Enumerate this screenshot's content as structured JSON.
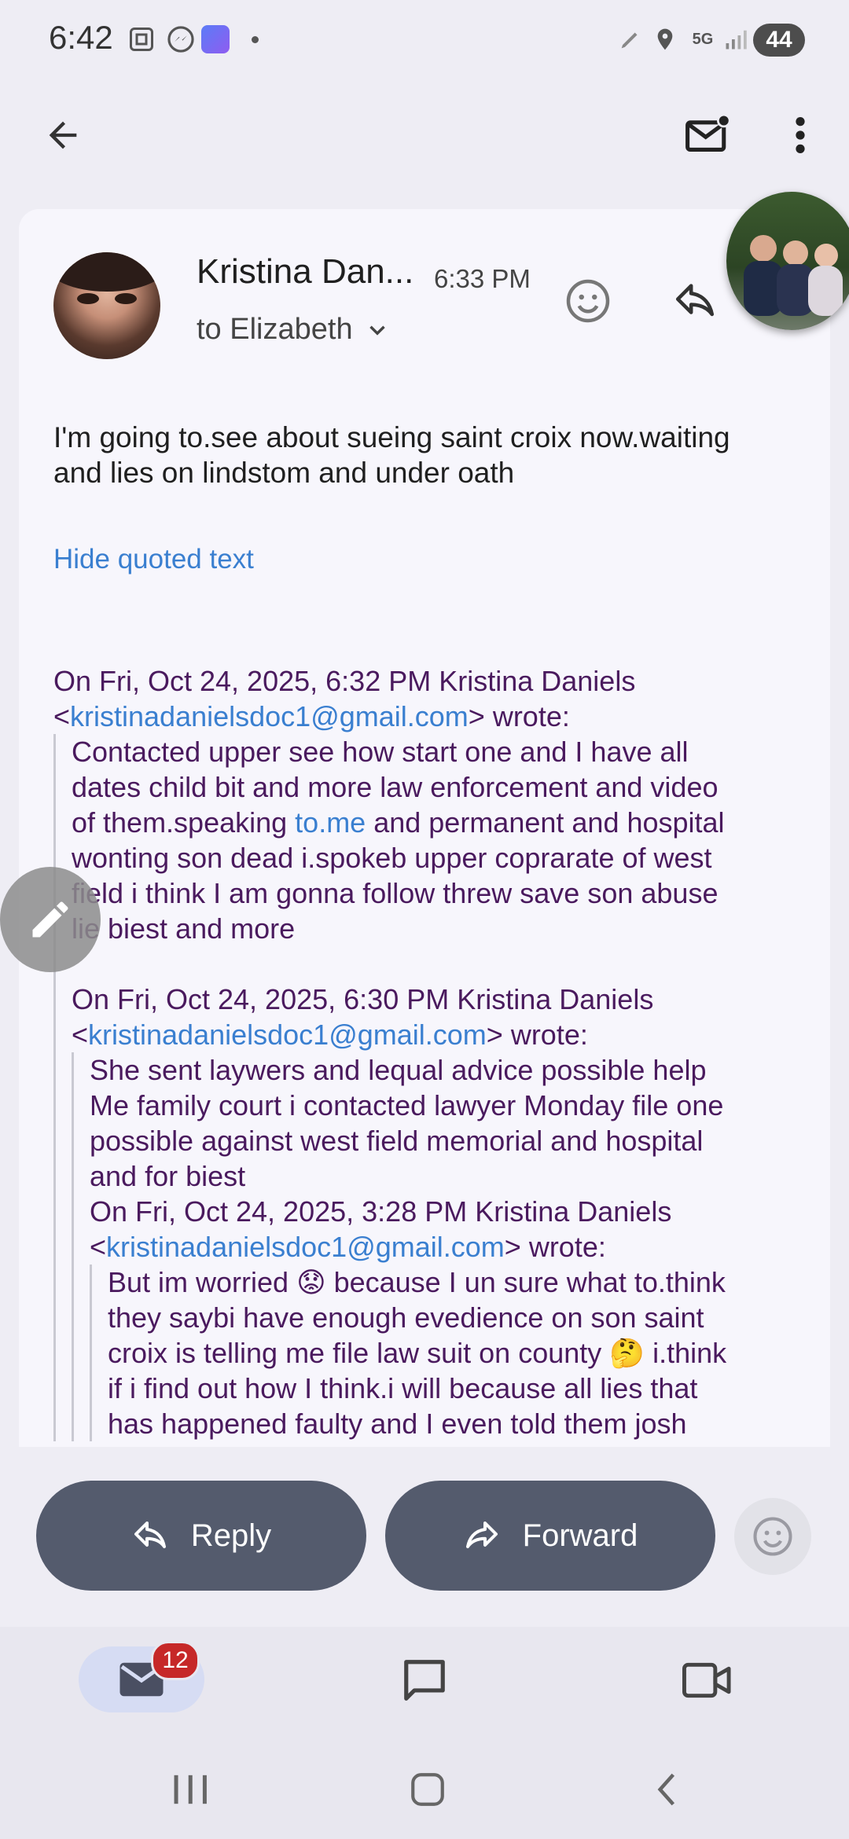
{
  "status_bar": {
    "time": "6:42",
    "network": "5G",
    "battery": "44",
    "icons": [
      "screenshot-icon",
      "messenger-icon",
      "app-icon",
      "dot-icon",
      "pen-icon",
      "location-icon",
      "network-5g-icon",
      "signal-icon",
      "battery-icon"
    ]
  },
  "app_bar": {
    "back_icon": "arrow-back-icon",
    "unread_icon": "mark-unread-icon",
    "more_icon": "more-vert-icon"
  },
  "message": {
    "sender_name": "Kristina Dan...",
    "time": "6:33 PM",
    "recipients": "to Elizabeth",
    "body_line1": "I'm going to.see about sueing saint croix now.waiting",
    "body_line2": "and lies on lindstom and under oath",
    "hide_quoted_label": "Hide quoted text"
  },
  "quotes": {
    "q1": {
      "header": "On Fri, Oct 24, 2025, 6:32 PM Kristina Daniels",
      "email": "kristinadanielsdoc1@gmail.com",
      "wrote": "> wrote:",
      "lines": [
        "Contacted upper see how start one and I have all",
        "dates child bit and more law enforcement and video"
      ],
      "line3_pre": "of them.speaking ",
      "line3_link": "to.me",
      "line3_post": " and permanent and hospital",
      "lines_after": [
        "wonting son dead i.spokeb upper coprarate of west",
        "field i think I am gonna follow threw save son abuse",
        "lie biest and more"
      ]
    },
    "q2": {
      "header": "On Fri, Oct 24, 2025, 6:30 PM Kristina Daniels",
      "email": "kristinadanielsdoc1@gmail.com",
      "wrote": "> wrote:",
      "lines": [
        "She sent laywers and lequal advice possible help",
        "Me family court i contacted lawyer Monday file one",
        "possible against west field memorial and hospital",
        "and for biest"
      ]
    },
    "q3": {
      "header": "On Fri, Oct 24, 2025, 3:28 PM Kristina Daniels",
      "email": "kristinadanielsdoc1@gmail.com",
      "wrote": "> wrote:",
      "line1": "But im worried 😟 because I un sure what to.think",
      "line2": "they saybi have enough evedience on son saint",
      "line3": "croix is telling me file law suit on county 🤔 i.think",
      "line4": "if i find out how I think.i will because all lies that",
      "line5": "has happened faulty and I even told them josh"
    }
  },
  "actions": {
    "reply_label": "Reply",
    "forward_label": "Forward"
  },
  "bottom_nav": {
    "mail_badge": "12",
    "tabs": [
      "mail-icon",
      "chat-icon",
      "meet-icon"
    ]
  },
  "colors": {
    "accent_link": "#3a7fd0",
    "quote_text": "#4a1a5e",
    "pill_bg": "#545b6d",
    "badge": "#c62828"
  }
}
